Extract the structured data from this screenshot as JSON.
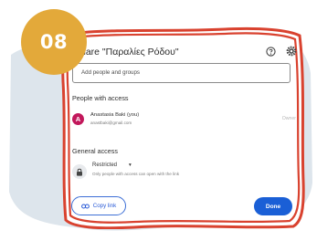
{
  "step": {
    "number": "08"
  },
  "dialog": {
    "title": "hare \"Παραλίες Ρόδου\"",
    "help_icon": "help-icon",
    "settings_icon": "gear-icon",
    "add_placeholder": "Add people and groups"
  },
  "people_section": {
    "title": "People with access",
    "people": [
      {
        "initial": "A",
        "name": "Anastasia Baki (you)",
        "email": "anastbaki@gmail.com",
        "role": "Owner"
      }
    ]
  },
  "general_section": {
    "title": "General access",
    "level": "Restricted",
    "caret": "▾",
    "description": "Only people with access can open with the link"
  },
  "footer": {
    "copy_link_label": "Copy link",
    "done_label": "Done"
  },
  "colors": {
    "frame": "#d9422f",
    "badge": "#e3a93a",
    "background_wave": "#dde5ec",
    "primary": "#1a5fd6",
    "avatar": "#c2185b"
  }
}
